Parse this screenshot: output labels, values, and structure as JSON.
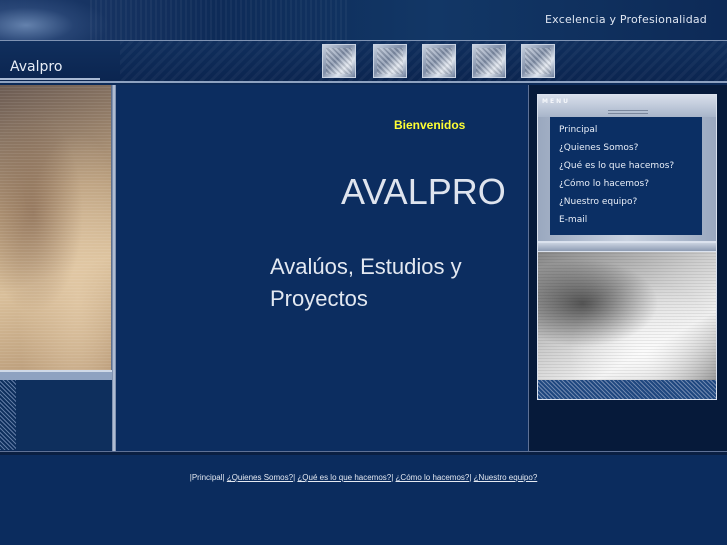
{
  "header": {
    "tagline": "Excelencia y Profesionalidad",
    "brand": "Avalpro"
  },
  "main": {
    "welcome": "Bienvenidos",
    "title": "AVALPRO",
    "subtitle": "Avalúos, Estudios y Proyectos"
  },
  "menu": {
    "title": "MENU",
    "items": [
      {
        "label": "Principal"
      },
      {
        "label": "¿Quienes Somos?"
      },
      {
        "label": "¿Qué es lo que hacemos?"
      },
      {
        "label": "¿Cómo lo hacemos?"
      },
      {
        "label": "¿Nuestro equipo?"
      },
      {
        "label": "E-mail"
      }
    ]
  },
  "footer": {
    "current": "|Principal|",
    "links": [
      {
        "label": "¿Quienes Somos?"
      },
      {
        "label": "¿Qué es lo que hacemos?"
      },
      {
        "label": "¿Cómo lo hacemos?"
      },
      {
        "label": "¿Nuestro equipo?"
      }
    ]
  },
  "colors": {
    "background": "#0c2d60",
    "accent": "#ffff33"
  }
}
